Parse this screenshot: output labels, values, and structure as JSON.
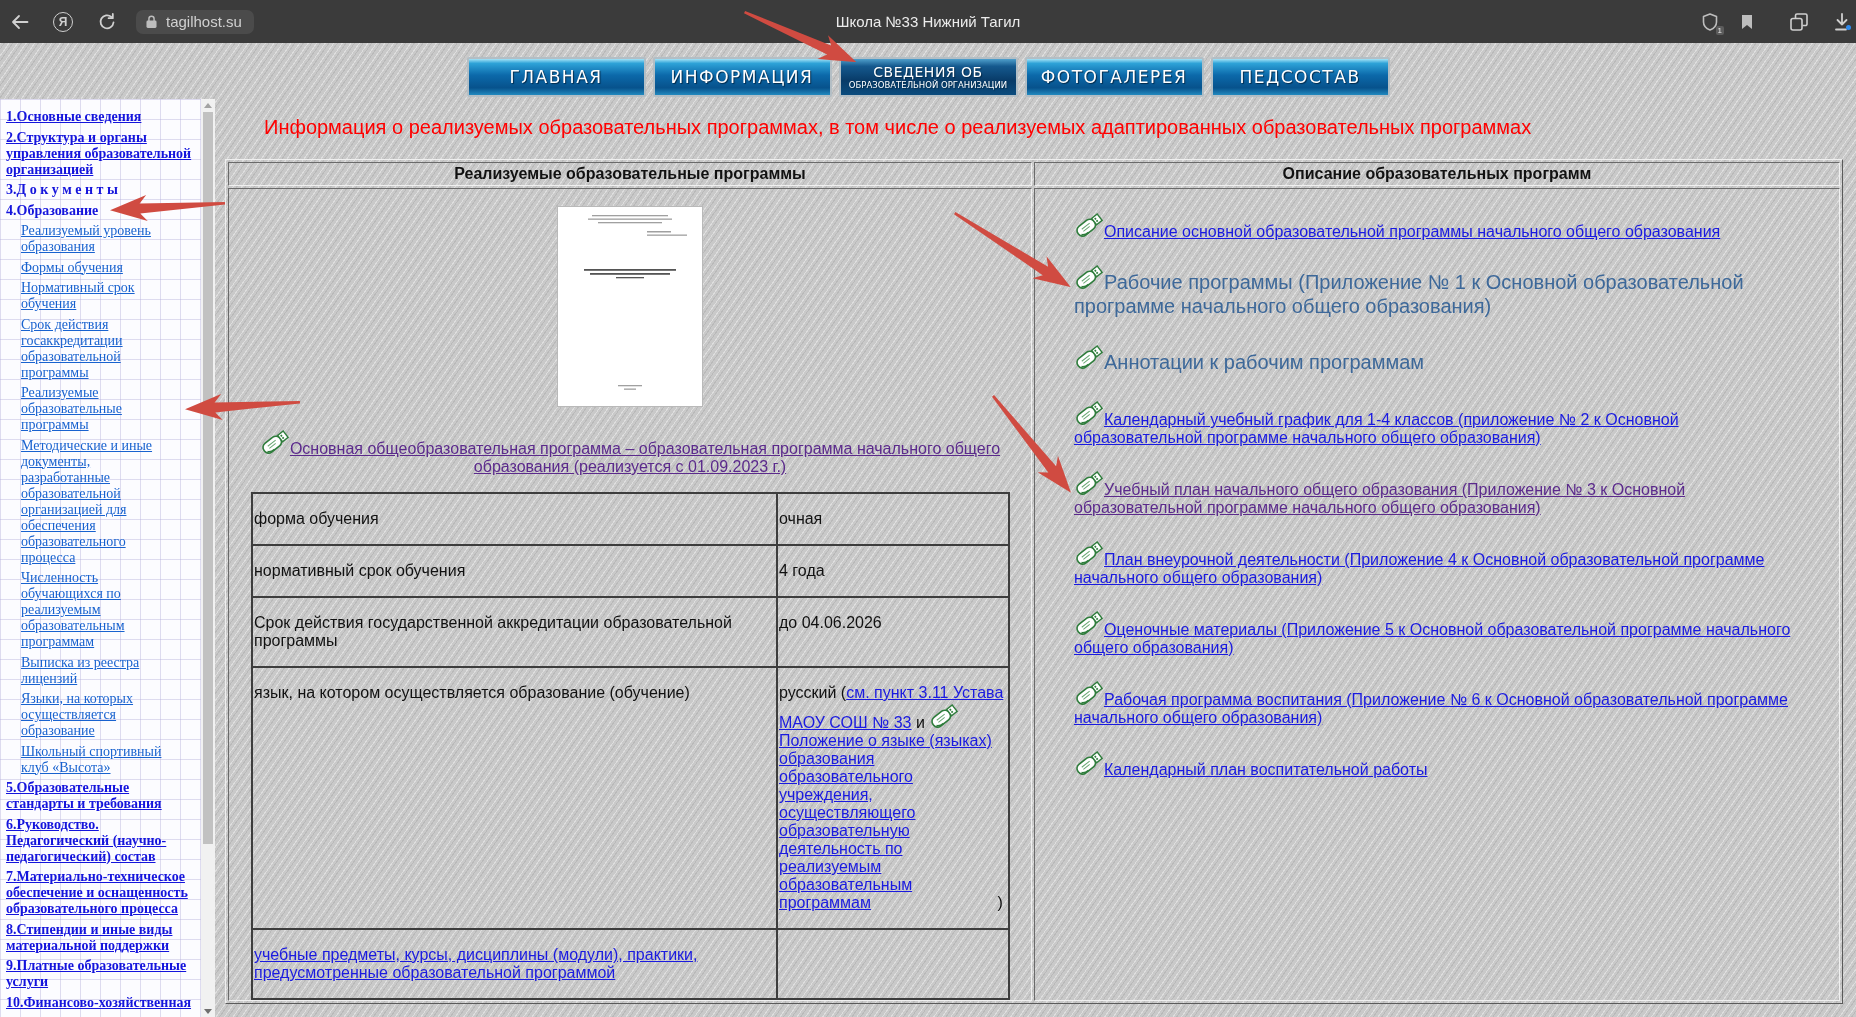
{
  "browser": {
    "logo_letter": "Я",
    "url": "tagilhost.su",
    "title": "Школа №33 Нижний Тагил",
    "badge": "1"
  },
  "nav": [
    {
      "label": "ГЛАВНАЯ",
      "selected": false
    },
    {
      "label": "ИНФОРМАЦИЯ",
      "selected": false
    },
    {
      "label": "СВЕДЕНИЯ ОБ",
      "sublabel": "ОБРАЗОВАТЕЛЬНОЙ ОРГАНИЗАЦИИ",
      "selected": true,
      "arrow": true
    },
    {
      "label": "ФОТОГАЛЕРЕЯ",
      "selected": false
    },
    {
      "label": "ПЕДСОСТАВ",
      "selected": false
    }
  ],
  "sidebar": {
    "items": [
      {
        "kind": "link",
        "text": "1.Основные сведения"
      },
      {
        "kind": "link",
        "text": "2.Структура и органы управления образовательной организацией"
      },
      {
        "kind": "group",
        "text": "3.Д о к у м е н т ы"
      },
      {
        "kind": "group",
        "text": "4.Образование",
        "arrow": true,
        "children": [
          {
            "text": "Реализуемый уровень образования"
          },
          {
            "text": "Формы обучения"
          },
          {
            "text": "Нормативный срок обучения"
          },
          {
            "text": "Срок действия госаккредитации образовательной программы"
          },
          {
            "text": "Реализуемые образовательные программы",
            "arrow": true
          },
          {
            "text": "Методические и иные документы, разработанные образовательной организацией для обеспечения образовательного процесса"
          },
          {
            "text": "Численность обучающихся по реализуемым образовательным программам"
          },
          {
            "text": "Выписка из реестра лицензий"
          },
          {
            "text": "Языки, на которых осуществляется образование"
          },
          {
            "text": "Школьный спортивный клуб «Высота»"
          }
        ]
      },
      {
        "kind": "link",
        "text": "5.Образовательные стандарты и требования"
      },
      {
        "kind": "link",
        "text": "6.Руководство. Педагогический (научно-педагогический) состав"
      },
      {
        "kind": "link",
        "text": "7.Материально-техническое обеспечение и оснащенность образовательного процесса"
      },
      {
        "kind": "link",
        "text": "8.Стипендии и иные виды материальной поддержки"
      },
      {
        "kind": "link",
        "text": "9.Платные образовательные услуги"
      },
      {
        "kind": "link",
        "text": "10.Финансово-хозяйственная"
      }
    ]
  },
  "heading": "Информация о реализуемых образовательных программах, в том числе о реализуемых адаптированных образовательных программах",
  "table": {
    "columns": [
      "Реализуемые образовательные программы",
      "Описание образовательных программ"
    ],
    "program": {
      "text": "Основная общеобразовательная программа – образовательная программа начального общего образования (реализуется с 01.09.2023 г.)",
      "visited": true
    },
    "details": [
      {
        "label": [
          {
            "kind": "text",
            "text": "форма обучения"
          }
        ],
        "value": [
          {
            "kind": "text",
            "text": "очная"
          }
        ]
      },
      {
        "label": [
          {
            "kind": "text",
            "text": "нормативный срок обучения"
          }
        ],
        "value": [
          {
            "kind": "text",
            "text": "4 года"
          }
        ]
      },
      {
        "label": [
          {
            "kind": "text",
            "text": "Срок действия государственной аккредитации образовательной программы"
          }
        ],
        "value": [
          {
            "kind": "text",
            "text": "до 04.06.2026"
          }
        ]
      },
      {
        "label": [
          {
            "kind": "text",
            "text": "язык, на котором осуществляется образование (обучение)"
          }
        ],
        "value": [
          {
            "kind": "text",
            "text": "русский ("
          },
          {
            "kind": "link",
            "text": "см. пункт 3.11 Устава",
            "visited": false
          },
          {
            "kind": "link",
            "text": "МАОУ СОШ № 33",
            "visited": false
          },
          {
            "kind": "text",
            "text": " и "
          },
          {
            "kind": "icon"
          },
          {
            "kind": "link",
            "text": "Положение о языке (языках) образования образовательного учреждения, осуществляющего образовательную деятельность по реализуемым образовательным программам",
            "visited": false
          },
          {
            "kind": "text",
            "text": " )"
          }
        ]
      },
      {
        "label": [
          {
            "kind": "link",
            "text": "учебные предметы, курсы, дисциплины (модули), практики, предусмотренные образовательной программой",
            "visited": false
          }
        ]
      }
    ],
    "documents": [
      {
        "kind": "link",
        "text": "Описание основной образовательной программы начального общего образования",
        "visited": false
      },
      {
        "kind": "title",
        "text": "Рабочие программы (Приложение № 1 к Основной образовательной программе начального общего образования)",
        "arrow": true
      },
      {
        "kind": "title",
        "text": "Аннотации к рабочим программам"
      },
      {
        "kind": "link",
        "text": "Календарный учебный график для 1-4 классов (приложение № 2 к Основной образовательной программе начального общего образования)",
        "visited": false
      },
      {
        "kind": "link",
        "text": "Учебный план начального общего образования (Приложение № 3 к Основной образовательной программе начального общего образования)",
        "visited": true,
        "arrow": true
      },
      {
        "kind": "link",
        "text": "План внеурочной деятельности (Приложение 4 к Основной образовательной программе начального общего образования)",
        "visited": false
      },
      {
        "kind": "link",
        "text": "Оценочные материалы (Приложение 5 к Основной образовательной программе начального общего образования)",
        "visited": false
      },
      {
        "kind": "link",
        "text": "Рабочая программа воспитания (Приложение № 6 к Основной образовательной программе начального общего образования)",
        "visited": false
      },
      {
        "kind": "link",
        "text": "Календарный план воспитательной работы",
        "visited": false
      }
    ]
  }
}
